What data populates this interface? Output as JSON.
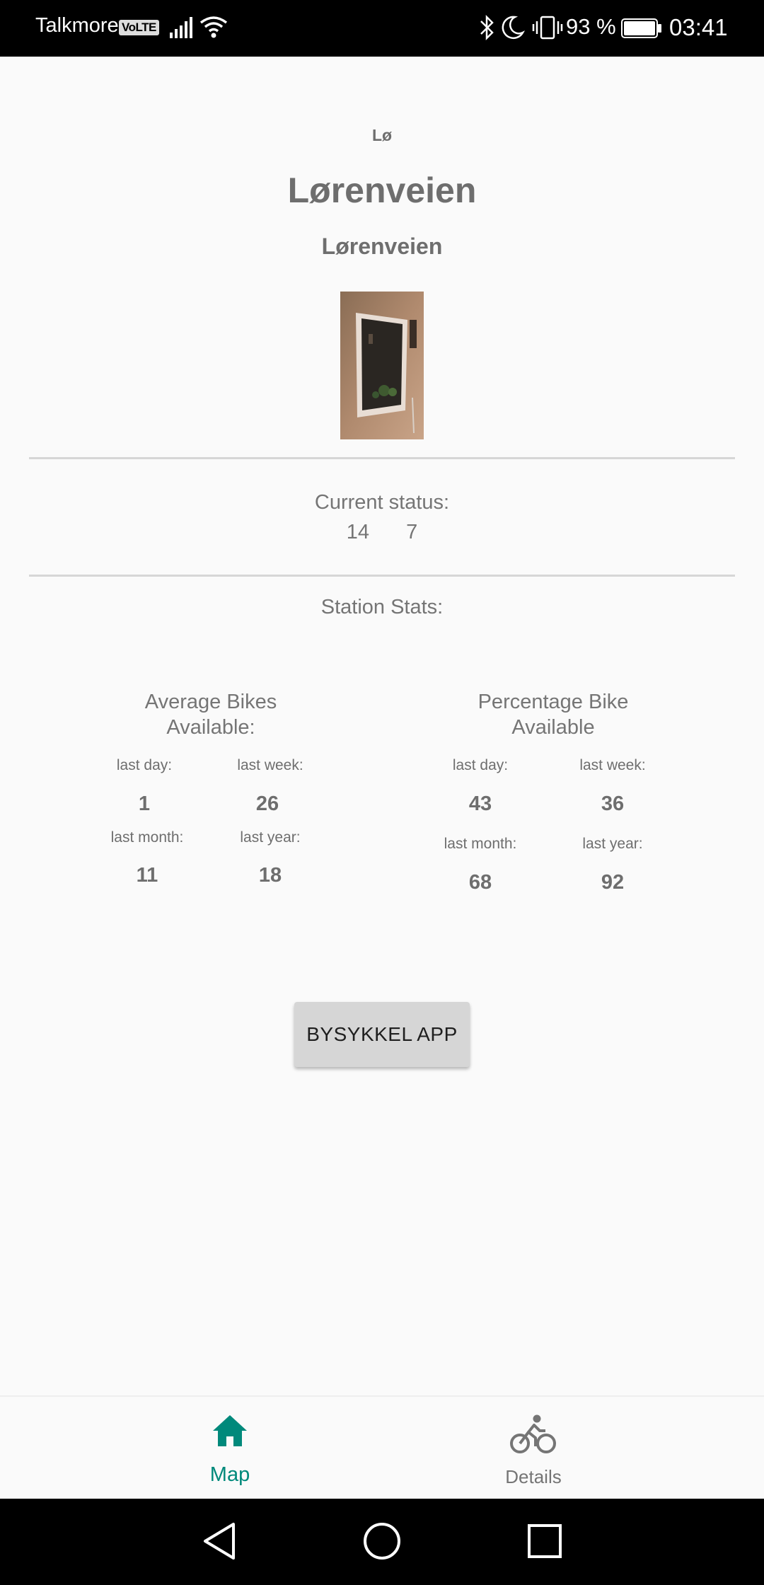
{
  "status_bar": {
    "carrier": "Talkmore",
    "volte": "VoLTE",
    "battery_percent": "93 %",
    "time": "03:41"
  },
  "station": {
    "short_name": "Lø",
    "title": "Lørenveien",
    "subtitle": "Lørenveien"
  },
  "current_status": {
    "label": "Current status:",
    "value_a": "14",
    "value_b": "7"
  },
  "stats": {
    "label": "Station Stats:",
    "average": {
      "heading_line1": "Average Bikes",
      "heading_line2": "Available:",
      "last_day_label": "last day:",
      "last_day_value": "1",
      "last_week_label": "last week:",
      "last_week_value": "26",
      "last_month_label": "last month:",
      "last_month_value": "11",
      "last_year_label": "last year:",
      "last_year_value": "18"
    },
    "percentage": {
      "heading_line1": "Percentage Bike",
      "heading_line2": "Available",
      "last_day_label": "last day:",
      "last_day_value": "43",
      "last_week_label": "last week:",
      "last_week_value": "36",
      "last_month_label": "last month:",
      "last_month_value": "68",
      "last_year_label": "last year:",
      "last_year_value": "92"
    }
  },
  "action": {
    "button_label": "BYSYKKEL APP"
  },
  "bottom_nav": {
    "items": [
      {
        "label": "Map",
        "icon": "home-icon",
        "active": true
      },
      {
        "label": "Details",
        "icon": "bicycle-icon",
        "active": false
      }
    ]
  },
  "colors": {
    "accent": "#00897b",
    "text_gray": "#6e6e6e",
    "button_bg": "#d6d6d6",
    "background": "#fafafa"
  }
}
